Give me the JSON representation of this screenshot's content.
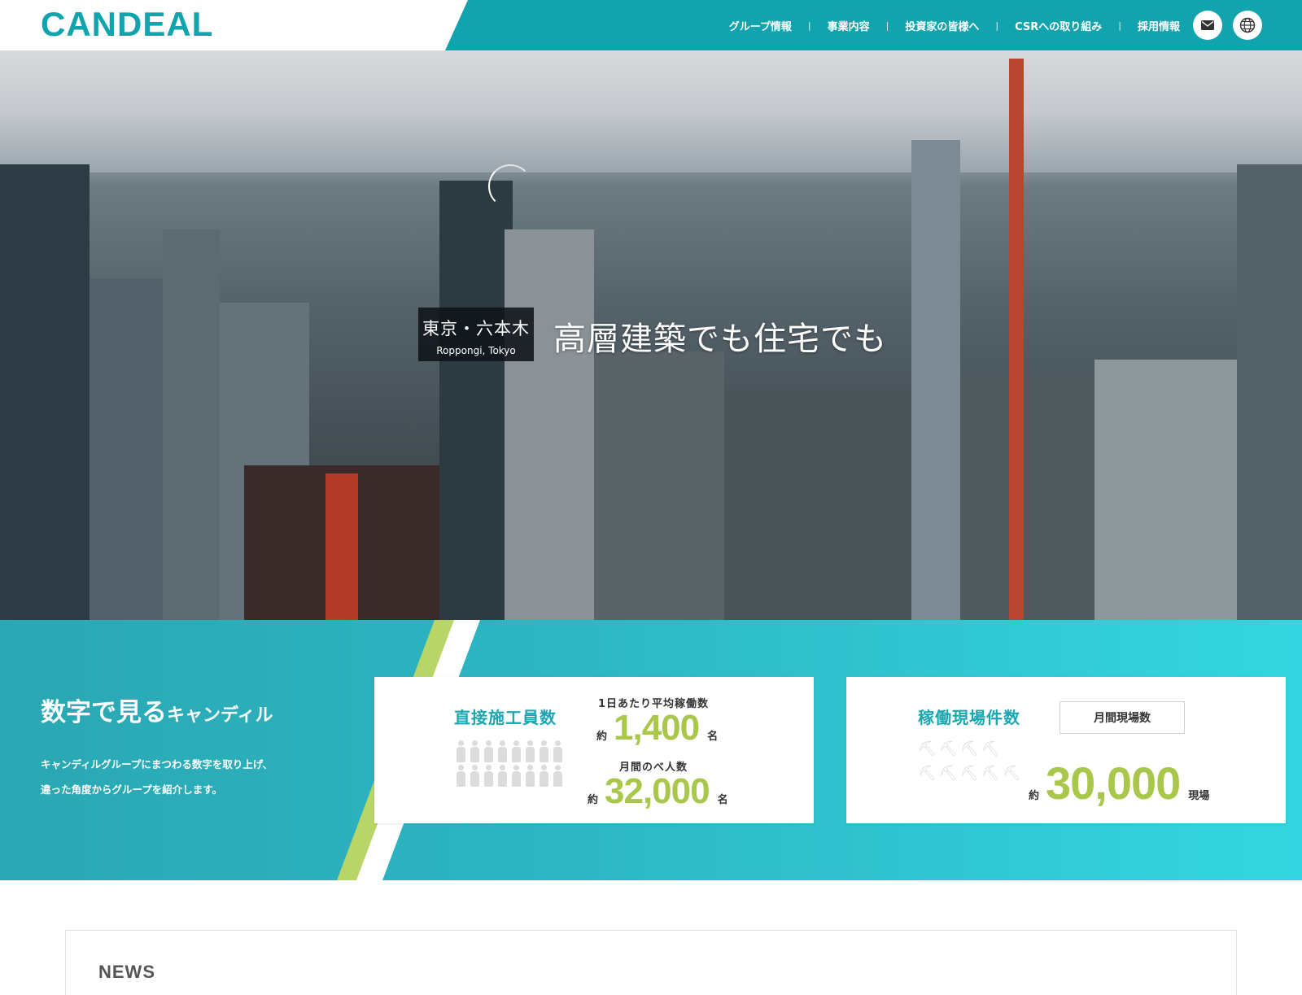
{
  "header": {
    "logo": "CANDEAL",
    "nav": [
      "グループ情報",
      "事業内容",
      "投資家の皆様へ",
      "CSRへの取り組み",
      "採用情報"
    ],
    "separator": "|",
    "icons": [
      "mail-icon",
      "globe-icon"
    ]
  },
  "hero": {
    "location_jp": "東京・六本木",
    "location_en": "Roppongi, Tokyo",
    "caption": "高層建築でも住宅でも"
  },
  "stats": {
    "title_main": "数字で見る",
    "title_small": "キャンディル",
    "desc_line1": "キャンディルグループにまつわる数字を取り上げ、",
    "desc_line2": "違った角度からグループを紹介します。",
    "card1": {
      "title": "直接施工員数",
      "label1": "1日あたり平均稼働数",
      "approx": "約",
      "value1": "1,400",
      "unit": "名",
      "label2": "月間のべ人数",
      "value2": "32,000"
    },
    "card2": {
      "title": "稼働現場件数",
      "box_label": "月間現場数",
      "approx": "約",
      "value": "30,000",
      "unit": "現場"
    }
  },
  "news": {
    "title": "NEWS"
  },
  "colors": {
    "teal": "#11a4ae",
    "lime": "#a9c84b",
    "aqua": "#33d6e0"
  }
}
